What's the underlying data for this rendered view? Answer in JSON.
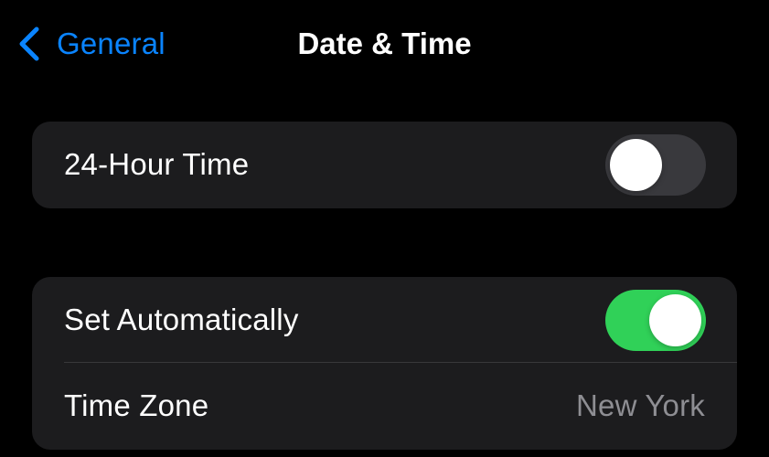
{
  "navbar": {
    "back_label": "General",
    "back_icon": "chevron-left-icon",
    "title": "Date & Time"
  },
  "colors": {
    "accent": "#0A84FF",
    "toggle_on": "#30D158",
    "toggle_off": "#39393D",
    "cell_background": "#1C1C1E",
    "secondary_text": "#8E8E93"
  },
  "settings": {
    "hour24": {
      "label": "24-Hour Time",
      "enabled": false
    },
    "set_automatically": {
      "label": "Set Automatically",
      "enabled": true
    },
    "time_zone": {
      "label": "Time Zone",
      "value": "New York"
    }
  }
}
